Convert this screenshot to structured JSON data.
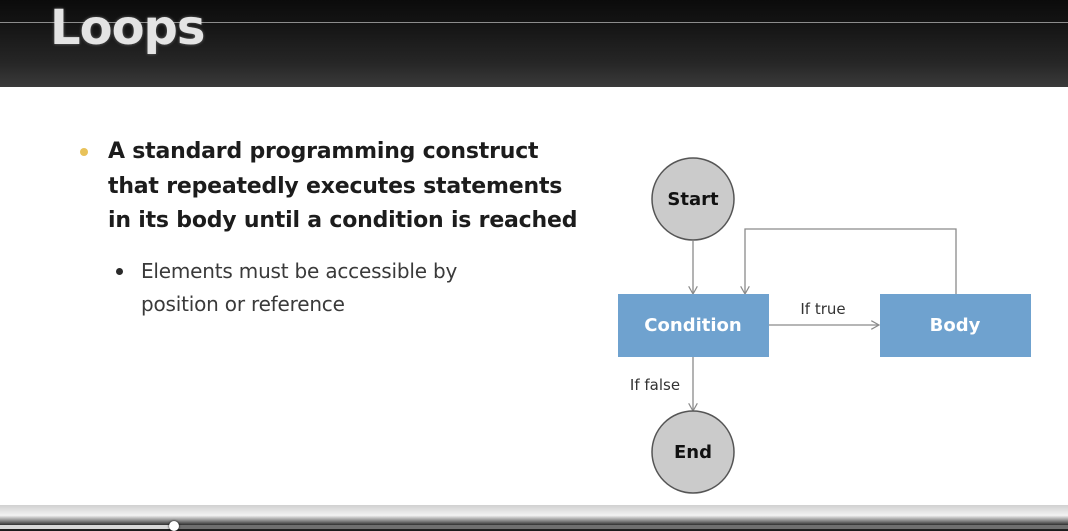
{
  "slide": {
    "title": "Loops",
    "bullet_main": "A standard programming construct that repeatedly executes statements in its body until a condition is reached",
    "bullet_sub": "Elements must be accessible by position or reference"
  },
  "diagram": {
    "nodes": {
      "start": "Start",
      "condition": "Condition",
      "body": "Body",
      "end": "End"
    },
    "edges": {
      "if_true": "If true",
      "if_false": "If false"
    }
  },
  "player": {
    "progress": 0.163
  },
  "colors": {
    "bullet_accent": "#e8c25a",
    "sub_bullet": "#2a2a2a",
    "box_fill": "#6fa2cf",
    "box_text": "#ffffff",
    "circle_fill": "#cbcbcb",
    "circle_stroke": "#555555",
    "circle_text": "#111111",
    "arrow": "#8a8a8a"
  }
}
